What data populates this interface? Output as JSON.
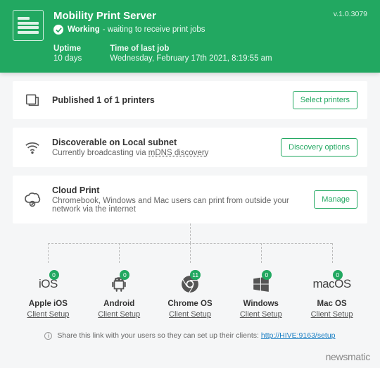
{
  "header": {
    "title": "Mobility Print Server",
    "status_working": "Working",
    "status_detail": "- waiting to receive print jobs",
    "uptime_label": "Uptime",
    "uptime_value": "10 days",
    "lastjob_label": "Time of last job",
    "lastjob_value": "Wednesday, February 17th 2021, 8:19:55 am",
    "version": "v.1.0.3079"
  },
  "cards": {
    "printers": {
      "title": "Published 1 of 1 printers",
      "button": "Select printers"
    },
    "discover": {
      "title": "Discoverable on Local subnet",
      "sub_prefix": "Currently broadcasting via ",
      "sub_link": "mDNS discovery",
      "button": "Discovery options"
    },
    "cloud": {
      "title": "Cloud Print",
      "sub": "Chromebook, Windows and Mac users can print from outside your network via the internet",
      "button": "Manage"
    }
  },
  "platforms": {
    "ios": {
      "icon_text": "iOS",
      "badge": "0",
      "name": "Apple iOS",
      "link": "Client Setup"
    },
    "android": {
      "badge": "0",
      "name": "Android",
      "link": "Client Setup"
    },
    "chrome": {
      "badge": "11",
      "name": "Chrome OS",
      "link": "Client Setup"
    },
    "windows": {
      "badge": "0",
      "name": "Windows",
      "link": "Client Setup"
    },
    "macos": {
      "icon_text": "macOS",
      "badge": "0",
      "name": "Mac OS",
      "link": "Client Setup"
    }
  },
  "share": {
    "text": "Share this link with your users so they can set up their clients: ",
    "url": "http://HIVE:9163/setup"
  },
  "watermark": "newsmatic"
}
